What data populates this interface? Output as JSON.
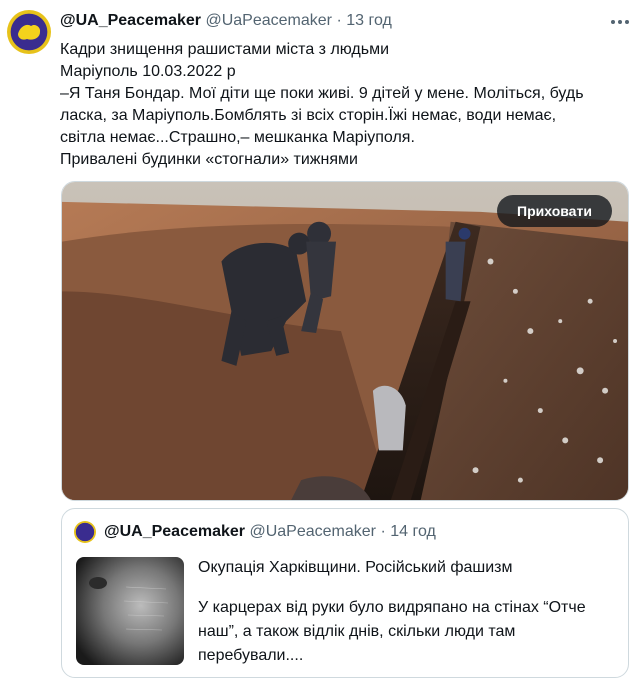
{
  "tweet": {
    "display_name": "@UA_Peacemaker",
    "handle": "@UaPeacemaker",
    "separator": "·",
    "time": "13 год",
    "more_icon": "more-icon",
    "lines": [
      "Кадри знищення рашистами міста з людьми",
      "Маріуполь 10.03.2022 р",
      "–Я Таня Бондар. Мої діти ще поки живі. 9 дітей у мене. Моліться, будь",
      "ласка, за Маріуполь.Бомблять зі всіх сторін.Їжі немає, води немає,",
      "світла немає...Страшно,– мешканка Маріуполя.",
      "Привалені будинки «стогнали» тижнями"
    ],
    "media": {
      "hide_button_label": "Приховати"
    }
  },
  "quoted_tweet": {
    "display_name": "@UA_Peacemaker",
    "handle": "@UaPeacemaker",
    "separator": "·",
    "time": "14 год",
    "paragraph1": "Окупація Харківщини. Російський фашизм",
    "paragraph2_lines": [
      "У карцерах від руки було видряпано на стінах “Отче",
      "наш”, а також відлік днів, скільки люди там",
      "перебували...."
    ]
  },
  "colors": {
    "text": "#0f1419",
    "muted": "#536471",
    "border": "#cfd9de",
    "avatar_blue": "#3a2c8f",
    "avatar_yellow": "#e7c21a"
  }
}
